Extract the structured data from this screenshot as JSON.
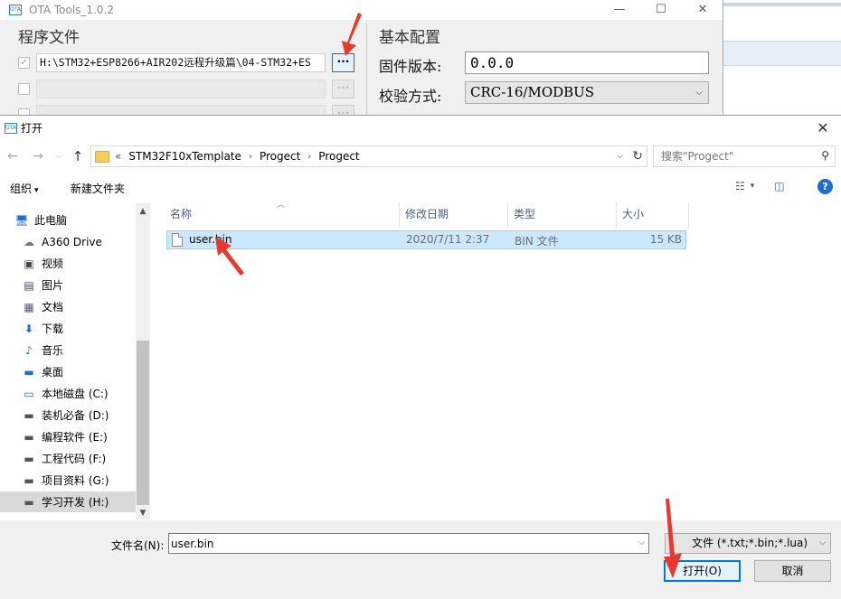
{
  "ota": {
    "title": "OTA Tools_1.0.2",
    "app_icon": "OTA",
    "controls": {
      "minimize": "—",
      "maximize": "☐",
      "close": "✕"
    },
    "program_group": "程序文件",
    "rows": [
      {
        "path": "H:\\STM32+ESP8266+AIR202远程升级篇\\04-STM32+ES",
        "checked": true
      },
      {
        "path": "",
        "checked": false
      },
      {
        "path": "",
        "checked": false
      }
    ],
    "browse_label": "···",
    "config_group": "基本配置",
    "firmware_label": "固件版本:",
    "firmware_value": "0.0.0",
    "checksum_label": "校验方式:",
    "checksum_value": "CRC-16/MODBUS"
  },
  "dialog": {
    "title": "打开",
    "app_icon": "OTA",
    "close": "✕",
    "crumbs_lead": "«",
    "crumbs": [
      "STM32F10xTemplate",
      "Progect",
      "Progect"
    ],
    "search_placeholder": "搜索\"Progect\"",
    "organize": "组织",
    "new_folder": "新建文件夹",
    "help": "?",
    "nav_items": [
      {
        "label": "此电脑",
        "icon": "computer-icon"
      },
      {
        "label": "A360 Drive",
        "icon": "cloud-drive-icon"
      },
      {
        "label": "视频",
        "icon": "video-icon"
      },
      {
        "label": "图片",
        "icon": "picture-icon"
      },
      {
        "label": "文档",
        "icon": "document-icon"
      },
      {
        "label": "下载",
        "icon": "download-icon"
      },
      {
        "label": "音乐",
        "icon": "music-icon"
      },
      {
        "label": "桌面",
        "icon": "desktop-icon"
      },
      {
        "label": "本地磁盘 (C:)",
        "icon": "system-drive-icon"
      },
      {
        "label": "装机必备 (D:)",
        "icon": "drive-icon"
      },
      {
        "label": "编程软件 (E:)",
        "icon": "drive-icon"
      },
      {
        "label": "工程代码 (F:)",
        "icon": "drive-icon"
      },
      {
        "label": "项目资料 (G:)",
        "icon": "drive-icon"
      },
      {
        "label": "学习开发 (H:)",
        "icon": "drive-icon"
      }
    ],
    "columns": {
      "name": "名称",
      "date": "修改日期",
      "type": "类型",
      "size": "大小"
    },
    "files": [
      {
        "name": "user.bin",
        "date": "2020/7/11 2:37",
        "type": "BIN 文件",
        "size": "15 KB"
      }
    ],
    "filename_label": "文件名(N):",
    "filename_value": "user.bin",
    "filter": "文件 (*.txt;*.bin;*.lua)",
    "open_button": "打开(O)",
    "cancel_button": "取消"
  },
  "colors": {
    "accent": "#0078d7",
    "selection": "#cce8ff",
    "annotation": "#e8392e"
  }
}
